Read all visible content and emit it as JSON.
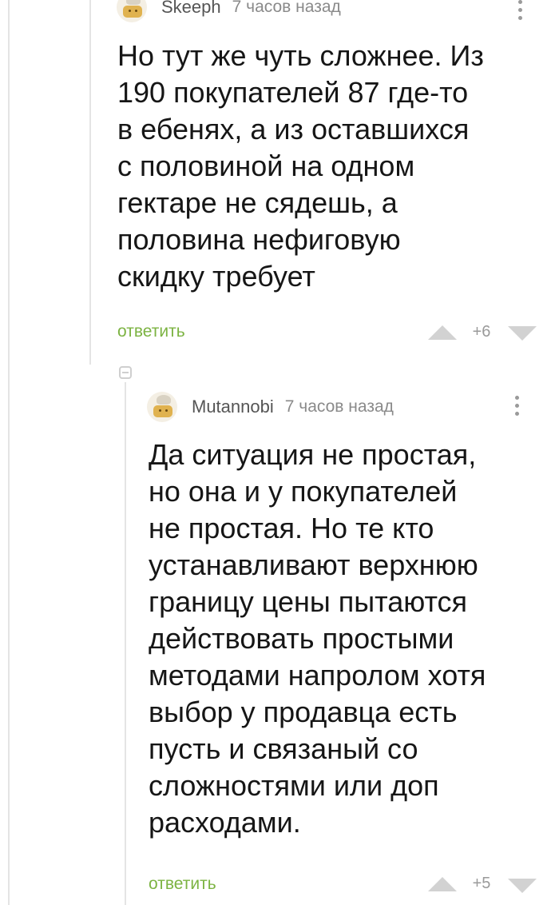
{
  "comments": [
    {
      "username": "Skeeph",
      "time": "7 часов назад",
      "text": "Но тут же чуть сложнее. Из\n190 покупателей 87 где-то\nв ебенях, а из оставшихся\nс половиной на одном\nгектаре не сядешь, а\nполовина нефиговую\nскидку требует",
      "reply_label": "ответить",
      "rating": "+6"
    },
    {
      "username": "Mutannobi",
      "time": "7 часов назад",
      "text": "Да ситуация не простая,\nно она и у покупателей\nне простая. Но те кто\nустанавливают верхнюю\nграницу цены пытаются\nдействовать простыми\nметодами напролом хотя\nвыбор у продавца есть\nпусть и связаный со\nсложностями или доп\nрасходами.",
      "reply_label": "ответить",
      "rating": "+5"
    }
  ],
  "colors": {
    "reply_link": "#7cb342",
    "vote_arrow": "#d2d2d2",
    "thread_line": "#e4e4e4"
  },
  "icons": [
    "avatar-chef",
    "more-vertical-icon",
    "upvote-icon",
    "downvote-icon",
    "collapse-icon"
  ]
}
